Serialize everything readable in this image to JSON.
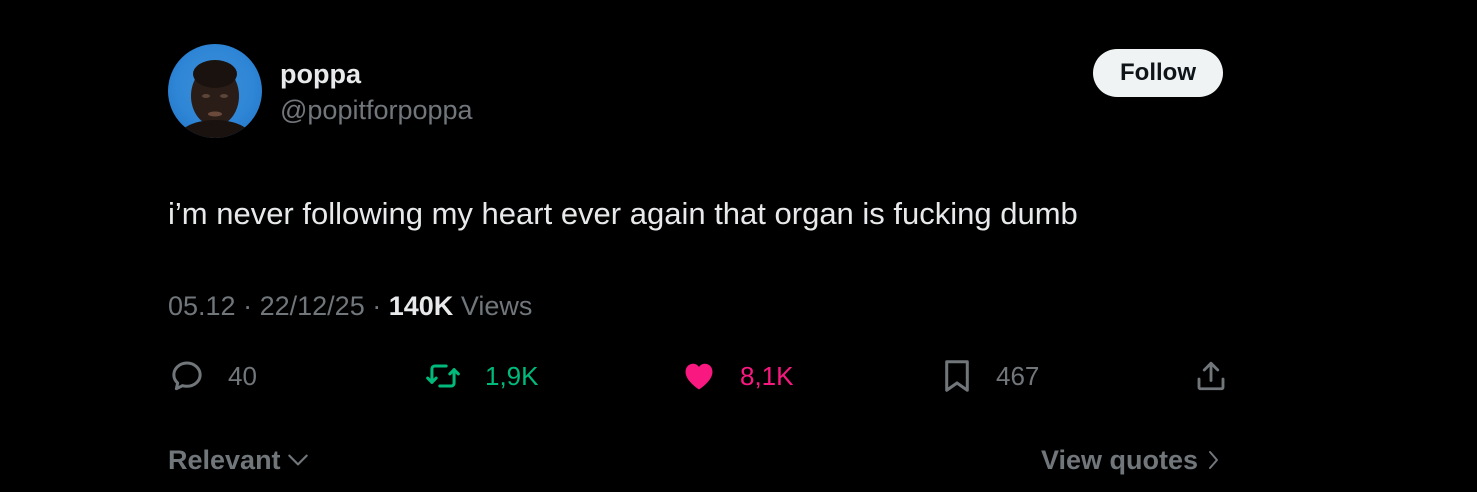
{
  "author": {
    "display_name": "poppa",
    "handle": "@popitforpoppa",
    "avatar_icon": "profile-photo"
  },
  "follow_button": {
    "label": "Follow"
  },
  "tweet": {
    "text": "i’m never following my heart ever again that organ is fucking dumb"
  },
  "meta": {
    "time": "05.12",
    "separator": "·",
    "date": "22/12/25",
    "views_count": "140K",
    "views_label": "Views"
  },
  "actions": {
    "reply": {
      "icon": "reply-icon",
      "count": "40"
    },
    "repost": {
      "icon": "repost-icon",
      "count": "1,9K",
      "color": "#00ba7c"
    },
    "like": {
      "icon": "heart-icon",
      "count": "8,1K",
      "color": "#f91880"
    },
    "bookmark": {
      "icon": "bookmark-icon",
      "count": "467"
    },
    "share": {
      "icon": "share-icon"
    }
  },
  "footer": {
    "sort_label": "Relevant",
    "quotes_label": "View quotes"
  },
  "colors": {
    "background": "#000000",
    "text_primary": "#e7e9ea",
    "text_secondary": "#71767b",
    "follow_bg": "#eff3f4"
  }
}
